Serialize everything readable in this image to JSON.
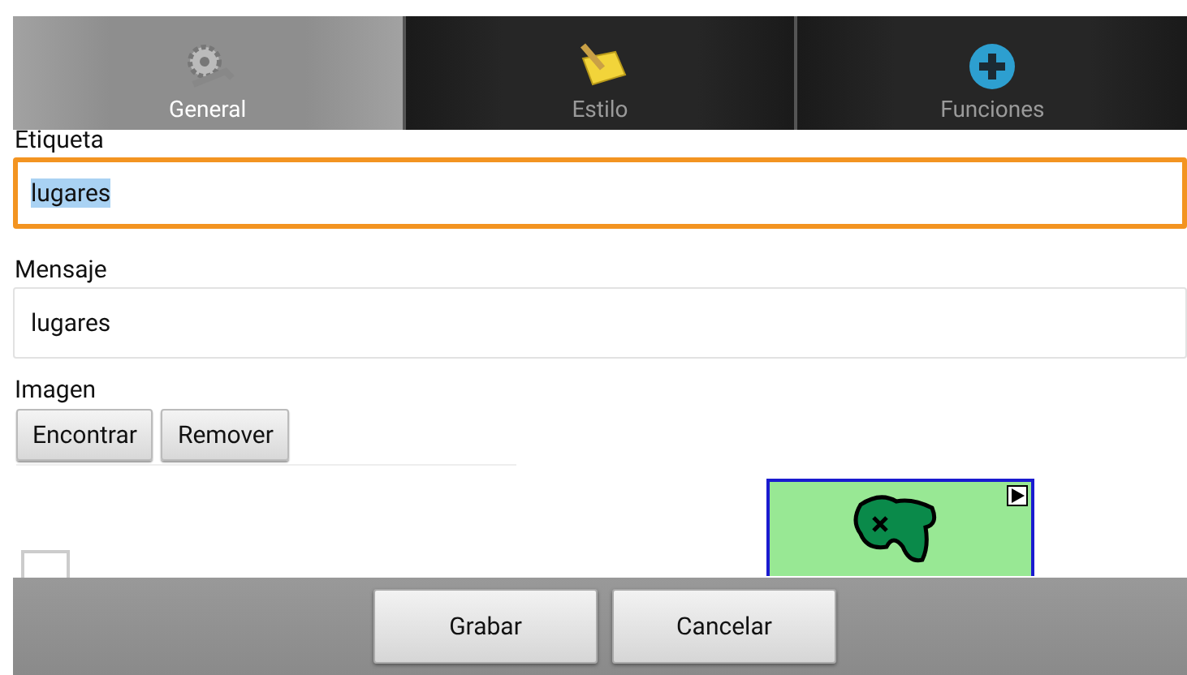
{
  "tabs": [
    {
      "label": "General",
      "kind": "gear",
      "selected": true
    },
    {
      "label": "Estilo",
      "kind": "note",
      "selected": false
    },
    {
      "label": "Funciones",
      "kind": "plus",
      "selected": false
    }
  ],
  "fields": [
    {
      "label": "Etiqueta",
      "value": "lugares",
      "focused": true,
      "text_selected": true
    },
    {
      "label": "Mensaje",
      "value": "lugares",
      "focused": false,
      "text_selected": false
    }
  ],
  "image": {
    "label": "Imagen",
    "buttons": [
      "Encontrar",
      "Remover"
    ],
    "checkbox_checked": false
  },
  "footer_buttons": [
    "Grabar",
    "Cancelar"
  ]
}
